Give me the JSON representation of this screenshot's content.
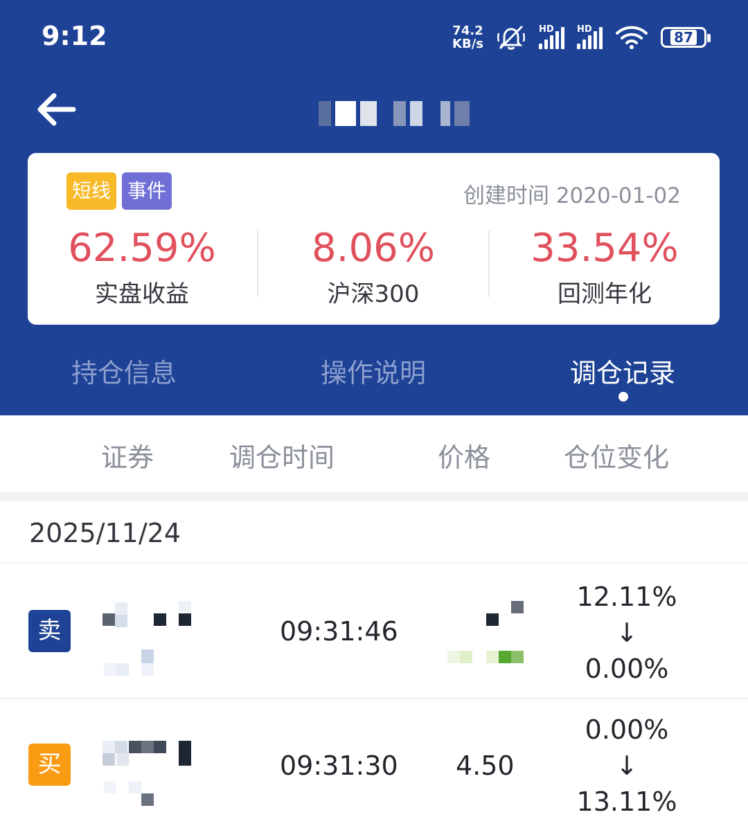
{
  "status_bar": {
    "time": "9:12",
    "net_speed_value": "74.2",
    "net_speed_unit": "KB/s",
    "signal_badge_1": "HD",
    "signal_badge_2": "HD",
    "battery": "87"
  },
  "nav": {
    "back_icon": "arrow-left-icon"
  },
  "card": {
    "tags": [
      "短线",
      "事件"
    ],
    "created_label": "创建时间",
    "created_date": "2020-01-02",
    "stats": [
      {
        "value": "62.59%",
        "label": "实盘收益"
      },
      {
        "value": "8.06%",
        "label": "沪深300"
      },
      {
        "value": "33.54%",
        "label": "回测年化"
      }
    ]
  },
  "tabs": [
    {
      "label": "持仓信息",
      "active": false
    },
    {
      "label": "操作说明",
      "active": false
    },
    {
      "label": "调仓记录",
      "active": true
    }
  ],
  "columns": [
    "证券",
    "调仓时间",
    "价格",
    "仓位变化"
  ],
  "records": {
    "date": "2025/11/24",
    "trades": [
      {
        "action": "卖",
        "time": "09:31:46",
        "price": "",
        "from": "12.11%",
        "arrow": "↓",
        "to": "0.00%"
      },
      {
        "action": "买",
        "time": "09:31:30",
        "price": "4.50",
        "from": "0.00%",
        "arrow": "↓",
        "to": "13.11%"
      }
    ]
  },
  "colors": {
    "header_bg": "#1d4296",
    "stat_red": "#e0505d",
    "tag_yellow": "#f7b928",
    "tag_purple": "#6f6fd6",
    "sell_badge": "#1d4296",
    "buy_badge": "#f99b13"
  }
}
